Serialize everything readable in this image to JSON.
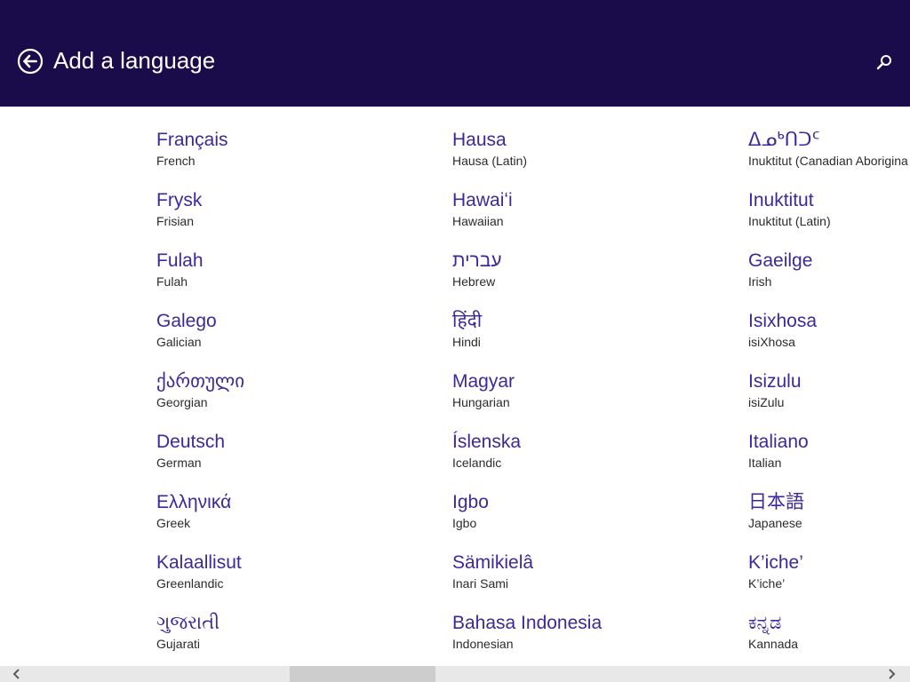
{
  "header": {
    "title": "Add a language",
    "background": "#1a0b4b",
    "back_icon": "back-arrow-circle-icon",
    "search_icon": "search-icon"
  },
  "languages": {
    "col1": [
      {
        "native": "Français",
        "english": "French"
      },
      {
        "native": "Frysk",
        "english": "Frisian"
      },
      {
        "native": "Fulah",
        "english": "Fulah"
      },
      {
        "native": "Galego",
        "english": "Galician"
      },
      {
        "native": "ქართული",
        "english": "Georgian"
      },
      {
        "native": "Deutsch",
        "english": "German"
      },
      {
        "native": "Ελληνικά",
        "english": "Greek"
      },
      {
        "native": "Kalaallisut",
        "english": "Greenlandic"
      },
      {
        "native": "ગુજરાતી",
        "english": "Gujarati"
      }
    ],
    "col2": [
      {
        "native": "Hausa",
        "english": "Hausa (Latin)"
      },
      {
        "native": "Hawaiʻi",
        "english": "Hawaiian"
      },
      {
        "native": "עברית",
        "english": "Hebrew"
      },
      {
        "native": "हिंदी",
        "english": "Hindi"
      },
      {
        "native": "Magyar",
        "english": "Hungarian"
      },
      {
        "native": "Íslenska",
        "english": "Icelandic"
      },
      {
        "native": "Igbo",
        "english": "Igbo"
      },
      {
        "native": "Sämikielâ",
        "english": "Inari Sami"
      },
      {
        "native": "Bahasa Indonesia",
        "english": "Indonesian"
      }
    ],
    "col3": [
      {
        "native": "ᐃᓄᒃᑎᑐᑦ",
        "english": "Inuktitut (Canadian Aborigina"
      },
      {
        "native": "Inuktitut",
        "english": "Inuktitut (Latin)"
      },
      {
        "native": "Gaeilge",
        "english": "Irish"
      },
      {
        "native": "Isixhosa",
        "english": "isiXhosa"
      },
      {
        "native": "Isizulu",
        "english": "isiZulu"
      },
      {
        "native": "Italiano",
        "english": "Italian"
      },
      {
        "native": "日本語",
        "english": "Japanese"
      },
      {
        "native": "K’iche’",
        "english": "K’iche’"
      },
      {
        "native": "ಕನ್ನಡ",
        "english": "Kannada"
      }
    ]
  },
  "colors": {
    "native_text": "#3b2a9a",
    "english_text": "#2b2b2b",
    "header_bg": "#1a0b4b"
  },
  "scrollbar": {
    "left_icon": "chevron-left-icon",
    "right_icon": "chevron-right-icon"
  }
}
